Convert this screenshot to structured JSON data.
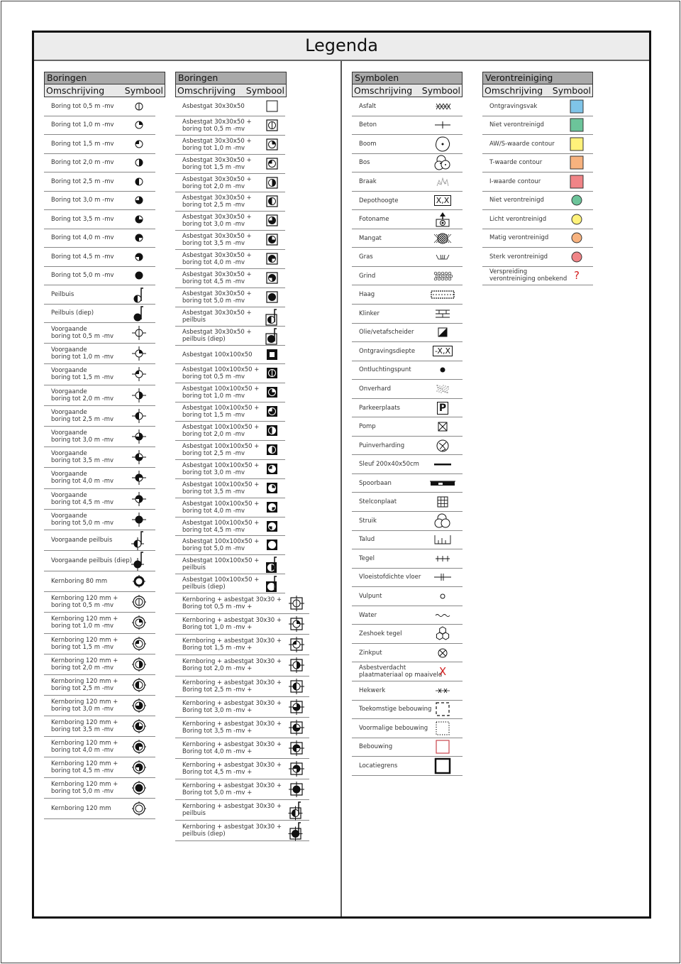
{
  "title": "Legenda",
  "header_cols": {
    "description": "Omschrijving",
    "symbol": "Symbool"
  },
  "colors": {
    "ontgravingsvak": "#7fc4e8",
    "niet_verontreinigd": "#6cc49a",
    "aws_waarde": "#fff27a",
    "t_waarde": "#f7b27e",
    "i_waarde": "#f08487",
    "circle_niet": "#6cc49a",
    "circle_licht": "#fff27a",
    "circle_matig": "#f7b27e",
    "circle_sterk": "#f08487",
    "asbest_red": "#d42020",
    "question_red": "#d42020",
    "bebouwing_red": "#c9444b"
  },
  "sections": [
    {
      "id": "boringen1",
      "title": "Boringen",
      "rows": [
        {
          "label": "Boring tot 0,5 m -mv",
          "icon": "boring",
          "fill": "0.5"
        },
        {
          "label": "Boring tot 1,0 m -mv",
          "icon": "boring",
          "fill": "1.0"
        },
        {
          "label": "Boring tot 1,5 m -mv",
          "icon": "boring",
          "fill": "1.5"
        },
        {
          "label": "Boring tot 2,0 m -mv",
          "icon": "boring",
          "fill": "2.0"
        },
        {
          "label": "Boring tot 2,5 m -mv",
          "icon": "boring",
          "fill": "2.5"
        },
        {
          "label": "Boring tot 3,0 m -mv",
          "icon": "boring",
          "fill": "3.0"
        },
        {
          "label": "Boring tot 3,5 m -mv",
          "icon": "boring",
          "fill": "3.5"
        },
        {
          "label": "Boring tot 4,0 m -mv",
          "icon": "boring",
          "fill": "4.0"
        },
        {
          "label": "Boring tot 4,5 m -mv",
          "icon": "boring",
          "fill": "4.5"
        },
        {
          "label": "Boring tot 5,0 m -mv",
          "icon": "boring",
          "fill": "5.0"
        },
        {
          "label": "Peilbuis",
          "icon": "peilbuis",
          "fill": "2.5"
        },
        {
          "label": "Peilbuis (diep)",
          "icon": "peilbuis",
          "fill": "5.0"
        },
        {
          "label": "Voorgaande\nboring tot 0,5 m -mv",
          "icon": "voorgaande",
          "fill": "0.5"
        },
        {
          "label": "Voorgaande\nboring tot 1,0 m -mv",
          "icon": "voorgaande",
          "fill": "1.0"
        },
        {
          "label": "Voorgaande\nboring tot 1,5 m -mv",
          "icon": "voorgaande",
          "fill": "1.5"
        },
        {
          "label": "Voorgaande\nboring tot 2,0 m -mv",
          "icon": "voorgaande",
          "fill": "2.0"
        },
        {
          "label": "Voorgaande\nboring tot 2,5 m -mv",
          "icon": "voorgaande",
          "fill": "2.5"
        },
        {
          "label": "Voorgaande\nboring tot 3,0 m -mv",
          "icon": "voorgaande",
          "fill": "3.0"
        },
        {
          "label": "Voorgaande\nboring tot 3,5 m -mv",
          "icon": "voorgaande",
          "fill": "3.5"
        },
        {
          "label": "Voorgaande\nboring tot 4,0 m -mv",
          "icon": "voorgaande",
          "fill": "4.0"
        },
        {
          "label": "Voorgaande\nboring tot 4,5 m -mv",
          "icon": "voorgaande",
          "fill": "4.5"
        },
        {
          "label": "Voorgaande\nboring tot 5,0 m -mv",
          "icon": "voorgaande",
          "fill": "5.0"
        },
        {
          "label": "Voorgaande peilbuis",
          "icon": "voorgaande-peilbuis",
          "fill": "2.5"
        },
        {
          "label": "Voorgaande peilbuis (diep)",
          "icon": "voorgaande-peilbuis",
          "fill": "5.0"
        },
        {
          "label": "Kernboring 80 mm",
          "icon": "kernboring80",
          "fill": "0"
        },
        {
          "label": "Kernboring 120 mm +\nboring tot 0,5 m -mv",
          "icon": "kernboring120",
          "fill": "0.5"
        },
        {
          "label": "Kernboring 120 mm +\nboring tot 1,0 m -mv",
          "icon": "kernboring120",
          "fill": "1.0"
        },
        {
          "label": "Kernboring 120 mm +\nboring tot 1,5 m -mv",
          "icon": "kernboring120",
          "fill": "1.5"
        },
        {
          "label": "Kernboring 120 mm +\nboring tot 2,0 m -mv",
          "icon": "kernboring120",
          "fill": "2.0"
        },
        {
          "label": "Kernboring 120 mm +\nboring tot 2,5 m -mv",
          "icon": "kernboring120",
          "fill": "2.5"
        },
        {
          "label": "Kernboring 120 mm +\nboring tot 3,0 m -mv",
          "icon": "kernboring120",
          "fill": "3.0"
        },
        {
          "label": "Kernboring 120 mm +\nboring tot 3,5 m -mv",
          "icon": "kernboring120",
          "fill": "3.5"
        },
        {
          "label": "Kernboring 120 mm +\nboring tot 4,0 m -mv",
          "icon": "kernboring120",
          "fill": "4.0"
        },
        {
          "label": "Kernboring 120 mm +\nboring tot 4,5 m -mv",
          "icon": "kernboring120",
          "fill": "4.5"
        },
        {
          "label": "Kernboring 120 mm +\nboring tot 5,0 m -mv",
          "icon": "kernboring120",
          "fill": "5.0"
        },
        {
          "label": "Kernboring 120 mm",
          "icon": "kernboring120-open",
          "fill": "0"
        }
      ]
    },
    {
      "id": "boringen2",
      "title": "Boringen",
      "rows": [
        {
          "label": "Asbestgat 30x30x50",
          "icon": "asbest30",
          "fill": "0"
        },
        {
          "label": "Asbestgat 30x30x50 +\nboring tot 0,5 m -mv",
          "icon": "asbest30-boring",
          "fill": "0.5"
        },
        {
          "label": "Asbestgat 30x30x50 +\nboring tot 1,0 m -mv",
          "icon": "asbest30-boring",
          "fill": "1.0"
        },
        {
          "label": "Asbestgat 30x30x50 +\nboring tot 1,5 m -mv",
          "icon": "asbest30-boring",
          "fill": "1.5"
        },
        {
          "label": "Asbestgat 30x30x50 +\nboring tot 2,0 m -mv",
          "icon": "asbest30-boring",
          "fill": "2.0"
        },
        {
          "label": "Asbestgat 30x30x50 +\nboring tot 2,5 m -mv",
          "icon": "asbest30-boring",
          "fill": "2.5"
        },
        {
          "label": "Asbestgat 30x30x50 +\nboring tot 3,0 m -mv",
          "icon": "asbest30-boring",
          "fill": "3.0"
        },
        {
          "label": "Asbestgat 30x30x50 +\nboring tot 3,5 m -mv",
          "icon": "asbest30-boring",
          "fill": "3.5"
        },
        {
          "label": "Asbestgat 30x30x50 +\nboring tot 4,0 m -mv",
          "icon": "asbest30-boring",
          "fill": "4.0"
        },
        {
          "label": "Asbestgat 30x30x50 +\nboring tot 4,5 m -mv",
          "icon": "asbest30-boring",
          "fill": "4.5"
        },
        {
          "label": "Asbestgat 30x30x50 +\nboring tot 5,0 m -mv",
          "icon": "asbest30-boring",
          "fill": "5.0"
        },
        {
          "label": "Asbestgat 30x30x50 +\npeilbuis",
          "icon": "asbest30-peilbuis",
          "fill": "2.5"
        },
        {
          "label": "Asbestgat 30x30x50 +\npeilbuis (diep)",
          "icon": "asbest30-peilbuis",
          "fill": "5.0"
        },
        {
          "label": "Asbestgat 100x100x50",
          "icon": "asbest100",
          "fill": "0"
        },
        {
          "label": "Asbestgat 100x100x50 +\nboring tot 0,5 m -mv",
          "icon": "asbest100-boring",
          "fill": "0.5"
        },
        {
          "label": "Asbestgat 100x100x50 +\nboring tot 1,0 m -mv",
          "icon": "asbest100-boring",
          "fill": "1.0"
        },
        {
          "label": "Asbestgat 100x100x50 +\nboring tot 1,5 m -mv",
          "icon": "asbest100-boring",
          "fill": "1.5"
        },
        {
          "label": "Asbestgat 100x100x50 +\nboring tot 2,0 m -mv",
          "icon": "asbest100-boring",
          "fill": "2.0"
        },
        {
          "label": "Asbestgat 100x100x50 +\nboring tot 2,5 m -mv",
          "icon": "asbest100-boring",
          "fill": "2.5"
        },
        {
          "label": "Asbestgat 100x100x50 +\nboring tot 3,0 m -mv",
          "icon": "asbest100-boring",
          "fill": "3.0"
        },
        {
          "label": "Asbestgat 100x100x50 +\nboring tot 3,5 m -mv",
          "icon": "asbest100-boring",
          "fill": "3.5"
        },
        {
          "label": "Asbestgat 100x100x50 +\nboring tot 4,0 m -mv",
          "icon": "asbest100-boring",
          "fill": "4.0"
        },
        {
          "label": "Asbestgat 100x100x50 +\nboring tot 4,5 m -mv",
          "icon": "asbest100-boring",
          "fill": "4.5"
        },
        {
          "label": "Asbestgat 100x100x50 +\nboring tot 5,0 m -mv",
          "icon": "asbest100-boring",
          "fill": "5.0"
        },
        {
          "label": "Asbestgat 100x100x50 +\npeilbuis",
          "icon": "asbest100-peilbuis",
          "fill": "2.5"
        },
        {
          "label": "Asbestgat 100x100x50 +\npeilbuis (diep)",
          "icon": "asbest100-peilbuis",
          "fill": "5.0"
        },
        {
          "label": "Kernboring + asbestgat 30x30 +\nBoring tot 0,5 m -mv +",
          "icon": "kern-asbest",
          "fill": "0.5"
        },
        {
          "label": "Kernboring + asbestgat 30x30 +\nBoring tot 1,0 m -mv +",
          "icon": "kern-asbest",
          "fill": "1.0"
        },
        {
          "label": "Kernboring + asbestgat 30x30 +\nBoring tot 1,5 m -mv +",
          "icon": "kern-asbest",
          "fill": "1.5"
        },
        {
          "label": "Kernboring + asbestgat 30x30 +\nBoring tot 2,0 m -mv +",
          "icon": "kern-asbest",
          "fill": "2.0"
        },
        {
          "label": "Kernboring + asbestgat 30x30 +\nBoring tot 2,5 m -mv +",
          "icon": "kern-asbest",
          "fill": "2.5"
        },
        {
          "label": "Kernboring + asbestgat 30x30 +\nBoring tot 3,0 m -mv +",
          "icon": "kern-asbest",
          "fill": "3.0"
        },
        {
          "label": "Kernboring + asbestgat 30x30 +\nBoring tot 3,5 m -mv +",
          "icon": "kern-asbest",
          "fill": "3.5"
        },
        {
          "label": "Kernboring + asbestgat 30x30 +\nBoring tot 4,0 m -mv +",
          "icon": "kern-asbest",
          "fill": "4.0"
        },
        {
          "label": "Kernboring + asbestgat 30x30 +\nBoring tot 4,5 m -mv +",
          "icon": "kern-asbest",
          "fill": "4.5"
        },
        {
          "label": "Kernboring + asbestgat 30x30 +\nBoring tot 5,0 m -mv +",
          "icon": "kern-asbest",
          "fill": "5.0"
        },
        {
          "label": "Kernboring + asbestgat 30x30 +\npeilbuis",
          "icon": "kern-asbest-peilbuis",
          "fill": "2.5"
        },
        {
          "label": "Kernboring + asbestgat 30x30 +\npeilbuis (diep)",
          "icon": "kern-asbest-peilbuis",
          "fill": "5.0"
        }
      ]
    },
    {
      "id": "symbolen",
      "title": "Symbolen",
      "rows": [
        {
          "label": "Asfalt",
          "icon": "asfalt"
        },
        {
          "label": "Beton",
          "icon": "beton"
        },
        {
          "label": "Boom",
          "icon": "boom"
        },
        {
          "label": "Bos",
          "icon": "bos"
        },
        {
          "label": "Braak",
          "icon": "braak"
        },
        {
          "label": "Depothoogte",
          "icon": "depothoogte",
          "text": "X,X"
        },
        {
          "label": "Fotoname",
          "icon": "fotoname"
        },
        {
          "label": "Mangat",
          "icon": "mangat"
        },
        {
          "label": "Gras",
          "icon": "gras"
        },
        {
          "label": "Grind",
          "icon": "grind"
        },
        {
          "label": "Haag",
          "icon": "haag"
        },
        {
          "label": "Klinker",
          "icon": "klinker"
        },
        {
          "label": "Olie/vetafscheider",
          "icon": "olie"
        },
        {
          "label": "Ontgravingsdiepte",
          "icon": "ontgravingsdiepte",
          "text": "-X,X"
        },
        {
          "label": "Ontluchtingspunt",
          "icon": "ontluchtingspunt"
        },
        {
          "label": "Onverhard",
          "icon": "onverhard"
        },
        {
          "label": "Parkeerplaats",
          "icon": "parkeerplaats",
          "text": "P"
        },
        {
          "label": "Pomp",
          "icon": "pomp"
        },
        {
          "label": "Puinverharding",
          "icon": "puinverharding"
        },
        {
          "label": "Sleuf 200x40x50cm",
          "icon": "sleuf"
        },
        {
          "label": "Spoorbaan",
          "icon": "spoorbaan"
        },
        {
          "label": "Stelconplaat",
          "icon": "stelconplaat"
        },
        {
          "label": "Struik",
          "icon": "struik"
        },
        {
          "label": "Talud",
          "icon": "talud"
        },
        {
          "label": "Tegel",
          "icon": "tegel"
        },
        {
          "label": "Vloeistofdichte vloer",
          "icon": "vloeistofdichte-vloer"
        },
        {
          "label": "Vulpunt",
          "icon": "vulpunt"
        },
        {
          "label": "Water",
          "icon": "water"
        },
        {
          "label": "Zeshoek tegel",
          "icon": "zeshoek"
        },
        {
          "label": "Zinkput",
          "icon": "zinkput"
        },
        {
          "label": "Asbestverdacht\nplaatmateriaal op maaiveld",
          "icon": "asbestverdacht",
          "text": "X"
        },
        {
          "label": "Hekwerk",
          "icon": "hekwerk"
        },
        {
          "label": "Toekomstige bebouwing",
          "icon": "toekomstige-bebouwing"
        },
        {
          "label": "Voormalige bebouwing",
          "icon": "voormalige-bebouwing"
        },
        {
          "label": "Bebouwing",
          "icon": "bebouwing"
        },
        {
          "label": "Locatiegrens",
          "icon": "locatiegrens"
        }
      ]
    },
    {
      "id": "verontreiniging",
      "title": "Verontreiniging",
      "rows": [
        {
          "label": "Ontgravingsvak",
          "icon": "color-square",
          "color": "ontgravingsvak"
        },
        {
          "label": "Niet verontreinigd",
          "icon": "color-square",
          "color": "niet_verontreinigd"
        },
        {
          "label": "AW/S-waarde contour",
          "icon": "color-square",
          "color": "aws_waarde"
        },
        {
          "label": "T-waarde contour",
          "icon": "color-square",
          "color": "t_waarde"
        },
        {
          "label": "I-waarde contour",
          "icon": "color-square",
          "color": "i_waarde"
        },
        {
          "label": "Niet verontreinigd",
          "icon": "color-circle",
          "color": "circle_niet"
        },
        {
          "label": "Licht verontreinigd",
          "icon": "color-circle",
          "color": "circle_licht"
        },
        {
          "label": "Matig verontreinigd",
          "icon": "color-circle",
          "color": "circle_matig"
        },
        {
          "label": "Sterk verontreinigd",
          "icon": "color-circle",
          "color": "circle_sterk"
        },
        {
          "label": "Verspreiding\nverontreiniging onbekend",
          "icon": "question",
          "text": "?"
        }
      ]
    }
  ]
}
